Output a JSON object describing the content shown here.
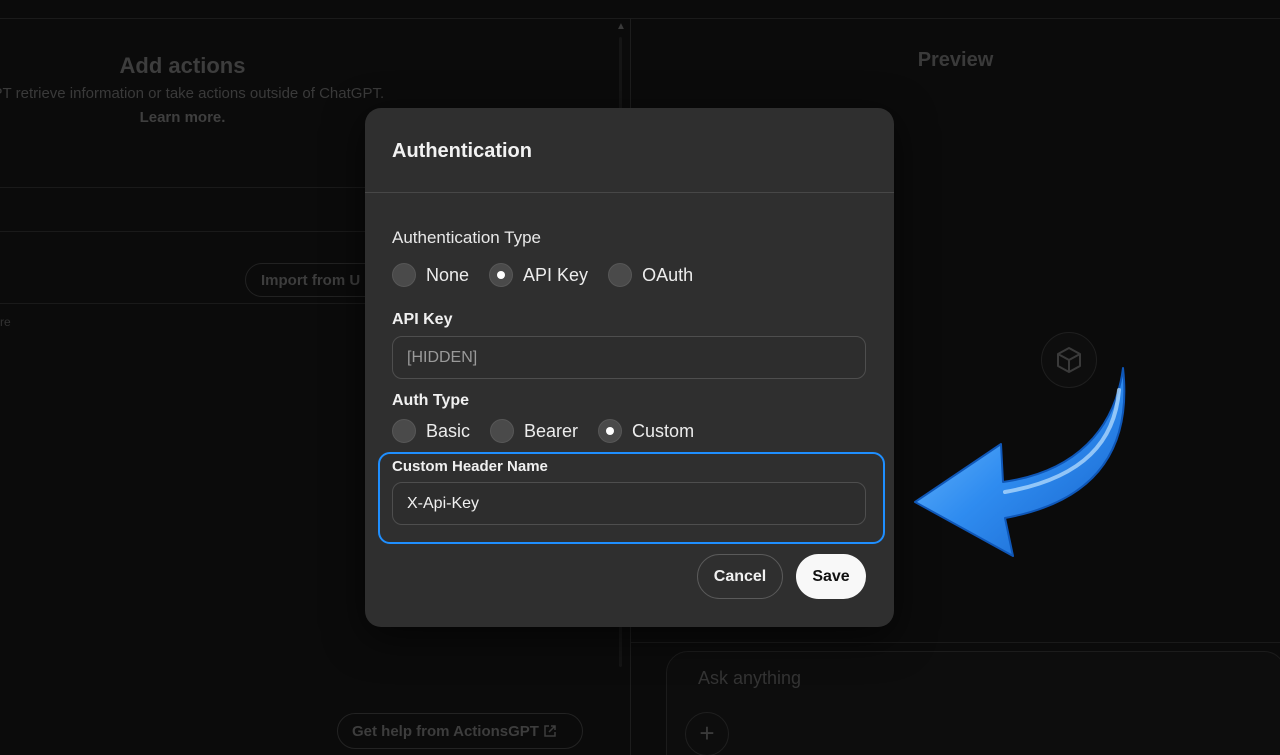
{
  "builder": {
    "title": "Add actions",
    "description": "GPT retrieve information or take actions outside of ChatGPT.",
    "learn_more": "Learn more.",
    "import_button": "Import from U",
    "schema_placeholder": "re",
    "help_button": "Get help from ActionsGPT"
  },
  "preview": {
    "title": "Preview",
    "input_placeholder": "Ask anything",
    "add_icon": "plus-icon",
    "avatar_icon": "cube-icon"
  },
  "modal": {
    "title": "Authentication",
    "auth_type_label": "Authentication Type",
    "auth_type_options": [
      {
        "label": "None",
        "selected": false
      },
      {
        "label": "API Key",
        "selected": true
      },
      {
        "label": "OAuth",
        "selected": false
      }
    ],
    "api_key_label": "API Key",
    "api_key_value": "[HIDDEN]",
    "auth_subtype_label": "Auth Type",
    "auth_subtype_options": [
      {
        "label": "Basic",
        "selected": false
      },
      {
        "label": "Bearer",
        "selected": false
      },
      {
        "label": "Custom",
        "selected": true
      }
    ],
    "custom_header_label": "Custom Header Name",
    "custom_header_value": "X-Api-Key",
    "cancel_label": "Cancel",
    "save_label": "Save"
  },
  "annotation": {
    "highlight_color": "#1f8fff",
    "arrow_color": "#2f8cf0",
    "arrow_icon": "curved-arrow-icon"
  }
}
